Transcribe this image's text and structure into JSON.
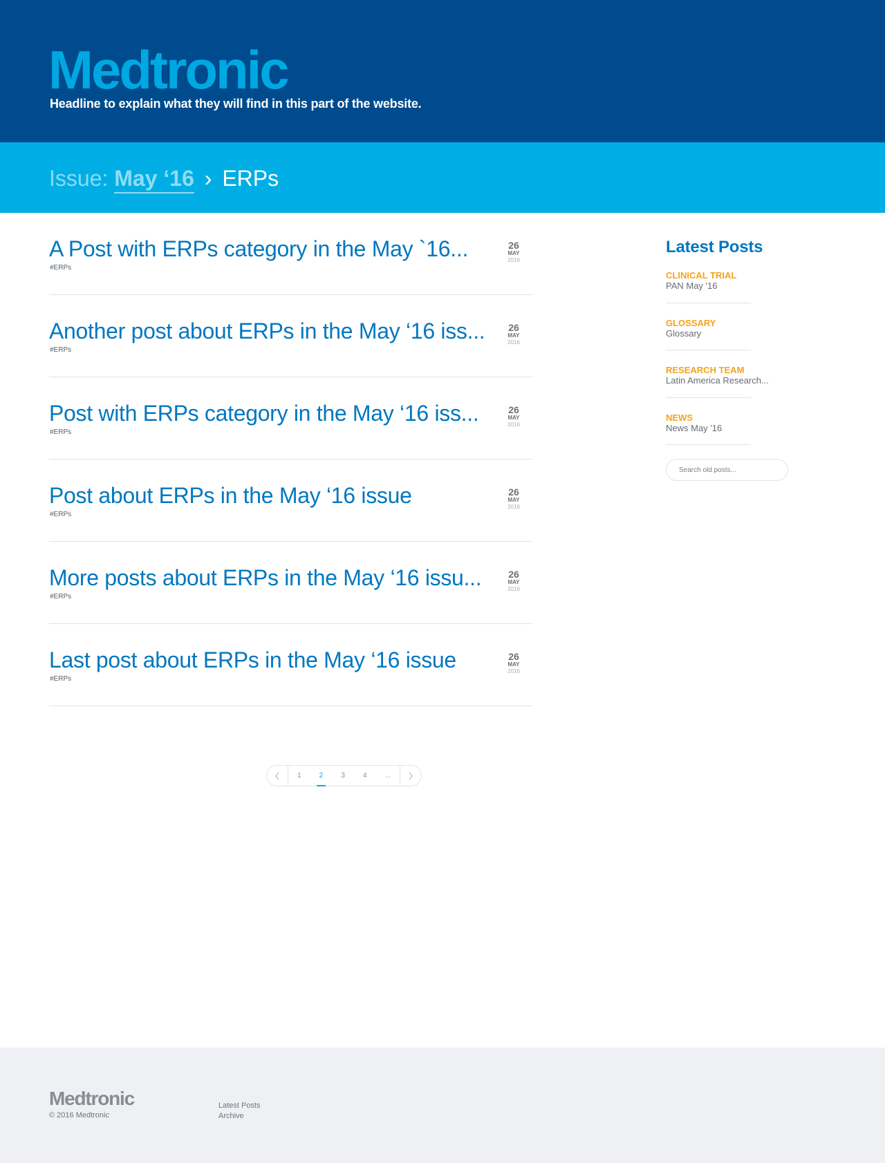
{
  "header": {
    "logo": "Medtronic",
    "tagline": "Headline to explain what they will find in this part of the website."
  },
  "breadcrumb": {
    "label": "Issue:",
    "issue": "May ‘16",
    "separator": "›",
    "current": "ERPs"
  },
  "posts": [
    {
      "title": "A Post with ERPs category  in the May `16...",
      "tag": "#ERPs",
      "day": "26",
      "month": "MAY",
      "year": "2016"
    },
    {
      "title": "Another post about ERPs in the May ‘16 iss...",
      "tag": "#ERPs",
      "day": "26",
      "month": "MAY",
      "year": "2016"
    },
    {
      "title": "Post with ERPs category in the May ‘16 iss...",
      "tag": "#ERPs",
      "day": "26",
      "month": "MAY",
      "year": "2016"
    },
    {
      "title": "Post about ERPs in the May ‘16 issue",
      "tag": "#ERPs",
      "day": "26",
      "month": "MAY",
      "year": "2016"
    },
    {
      "title": "More posts about ERPs in the May ‘16 issu...",
      "tag": "#ERPs",
      "day": "26",
      "month": "MAY",
      "year": "2016"
    },
    {
      "title": "Last post about ERPs in the May ‘16 issue",
      "tag": "#ERPs",
      "day": "26",
      "month": "MAY",
      "year": "2016"
    }
  ],
  "pagination": {
    "prev_icon": "chevron-left-icon",
    "next_icon": "chevron-right-icon",
    "pages": [
      "1",
      "2",
      "3",
      "4",
      "..."
    ],
    "active": "2"
  },
  "sidebar": {
    "title": "Latest Posts",
    "items": [
      {
        "category": "CLINICAL TRIAL",
        "name": "PAN May '16"
      },
      {
        "category": "GLOSSARY",
        "name": "Glossary"
      },
      {
        "category": "RESEARCH TEAM",
        "name": "Latin America Research..."
      },
      {
        "category": "NEWS",
        "name": "News May '16"
      }
    ],
    "search_placeholder": "Search old posts..."
  },
  "footer": {
    "logo": "Medtronic",
    "copyright": "© 2016 Medtronic",
    "links": [
      "Latest Posts",
      "Archive"
    ]
  },
  "colors": {
    "header_bg": "#004b8d",
    "logo": "#00a8e1",
    "breadcrumb_bg": "#00aee5",
    "post_title": "#0077c0",
    "category_accent": "#f5a31a",
    "footer_bg": "#eff0f4"
  }
}
